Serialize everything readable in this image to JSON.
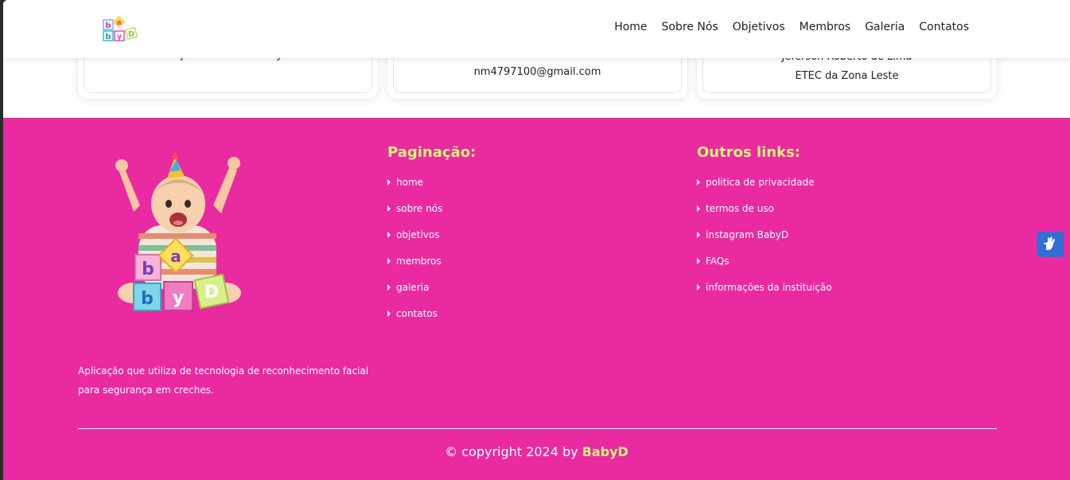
{
  "header": {
    "logo_alt": "BabyD",
    "nav": [
      "Home",
      "Sobre Nós",
      "Objetivos",
      "Membros",
      "Galeria",
      "Contatos"
    ]
  },
  "cards": {
    "card1": {
      "line1": "Repositório do BabyD"
    },
    "card2": {
      "line1": "",
      "line2": "nm4797100@gmail.com"
    },
    "card3": {
      "line1": "Jeferson Roberto de Lima",
      "line2": "ETEC da Zona Leste"
    }
  },
  "footer": {
    "pagination_title": "Paginação:",
    "pagination_links": [
      "home",
      "sobre nós",
      "objetivos",
      "membros",
      "galeria",
      "contatos"
    ],
    "other_title": "Outros links:",
    "other_links": [
      "politica de privacidade",
      "termos de uso",
      "instagram BabyD",
      "FAQs",
      "informações da instituição"
    ],
    "description": "Aplicação que utiliza de tecnologia de reconhecimento facial para segurança em creches.",
    "copyright_prefix": "© copyright 2024 by",
    "copyright_brand": "BabyD"
  },
  "colors": {
    "footer_bg": "#ea2aa0",
    "accent": "#d9f27a",
    "a11y_button": "#2f6fd6"
  },
  "icons": {
    "accessibility": "hand-sign-language-icon"
  }
}
